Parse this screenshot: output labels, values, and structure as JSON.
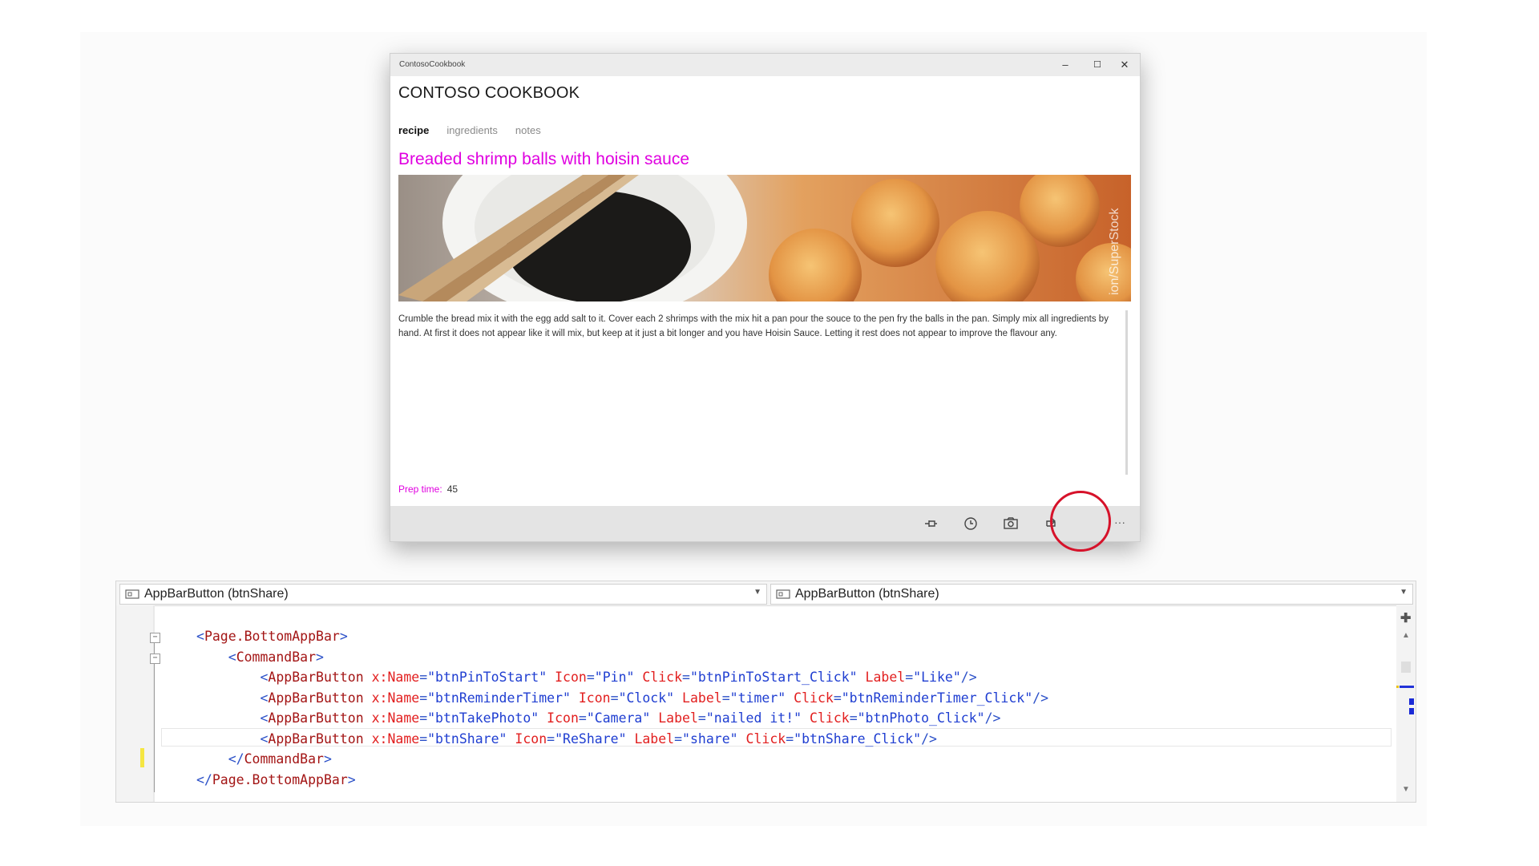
{
  "window": {
    "title": "ContosoCookbook",
    "minimize_glyph": "–",
    "maximize_glyph": "☐",
    "close_glyph": "✕"
  },
  "app": {
    "title": "CONTOSO COOKBOOK",
    "pivot": [
      {
        "label": "recipe",
        "active": true
      },
      {
        "label": "ingredients",
        "active": false
      },
      {
        "label": "notes",
        "active": false
      }
    ]
  },
  "recipe": {
    "title": "Breaded shrimp balls with hoisin sauce",
    "image_credit": "ion/SuperStock",
    "description": "Crumble the bread mix it with the egg add salt to it. Cover each 2 shrimps with the mix hit a pan pour the souce to the pen fry the balls in the pan. Simply mix all ingredients by hand. At first it does not appear like it will mix, but keep at it just a bit longer and you have Hoisin Sauce. Letting it rest does not appear to improve the flavour any.",
    "prep_label": "Prep time:",
    "prep_value": "45"
  },
  "appbar": {
    "buttons": [
      {
        "icon": "pin-icon"
      },
      {
        "icon": "clock-icon"
      },
      {
        "icon": "camera-icon"
      },
      {
        "icon": "reshare-icon",
        "highlighted": true
      }
    ],
    "more_glyph": "···"
  },
  "editor": {
    "left_dropdown": "AppBarButton (btnShare)",
    "right_dropdown": "AppBarButton (btnShare)",
    "code_lines": [
      "<Page.BottomAppBar>",
      "    <CommandBar>",
      "        <AppBarButton x:Name=\"btnPinToStart\" Icon=\"Pin\" Click=\"btnPinToStart_Click\" Label=\"Like\"/>",
      "        <AppBarButton x:Name=\"btnReminderTimer\" Icon=\"Clock\" Label=\"timer\" Click=\"btnReminderTimer_Click\"/>",
      "        <AppBarButton x:Name=\"btnTakePhoto\" Icon=\"Camera\" Label=\"nailed it!\" Click=\"btnPhoto_Click\"/>",
      "        <AppBarButton x:Name=\"btnShare\" Icon=\"ReShare\" Label=\"share\" Click=\"btnShare_Click\"/>",
      "    </CommandBar>",
      "</Page.BottomAppBar>"
    ]
  },
  "colors": {
    "accent_magenta": "#e000e0",
    "highlight_red": "#d6122a",
    "code_tag": "#a31515",
    "code_attr": "#e21f1f",
    "code_value": "#1f3ed1"
  }
}
